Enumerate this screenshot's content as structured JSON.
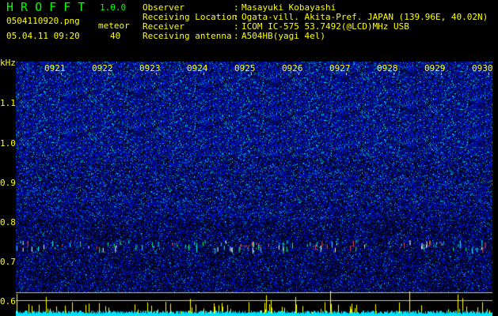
{
  "header": {
    "app_title": "H R O F F T",
    "version": "1.0.0",
    "filename": "0504110920.png",
    "datetime": "05.04.11 09:20",
    "meteor_label": "meteor",
    "meteor_count": "40"
  },
  "info": [
    {
      "label": "Observer",
      "value": "Masayuki Kobayashi"
    },
    {
      "label": "Receiving Location",
      "value": "Ogata-vill. Akita-Pref. JAPAN (139.96E, 40.02N)"
    },
    {
      "label": "Receiver",
      "value": "ICOM IC-575 53.7492(@LCD)MHz USB"
    },
    {
      "label": "Receiving antenna",
      "value": "A504HB(yagi 4el)"
    }
  ],
  "spectrogram": {
    "y_unit": "kHz",
    "y_ticks": [
      "1.1",
      "1.0",
      "0.9",
      "0.8",
      "0.7",
      "0.6"
    ],
    "time_labels": [
      "0921",
      "0922",
      "0923",
      "0924",
      "0925",
      "0926",
      "0927",
      "0928",
      "0929",
      "0930"
    ],
    "colors": {
      "background": "#000000",
      "noise": "#0a1fd0",
      "text": "#ffff00",
      "detection": "#00ffff"
    }
  }
}
